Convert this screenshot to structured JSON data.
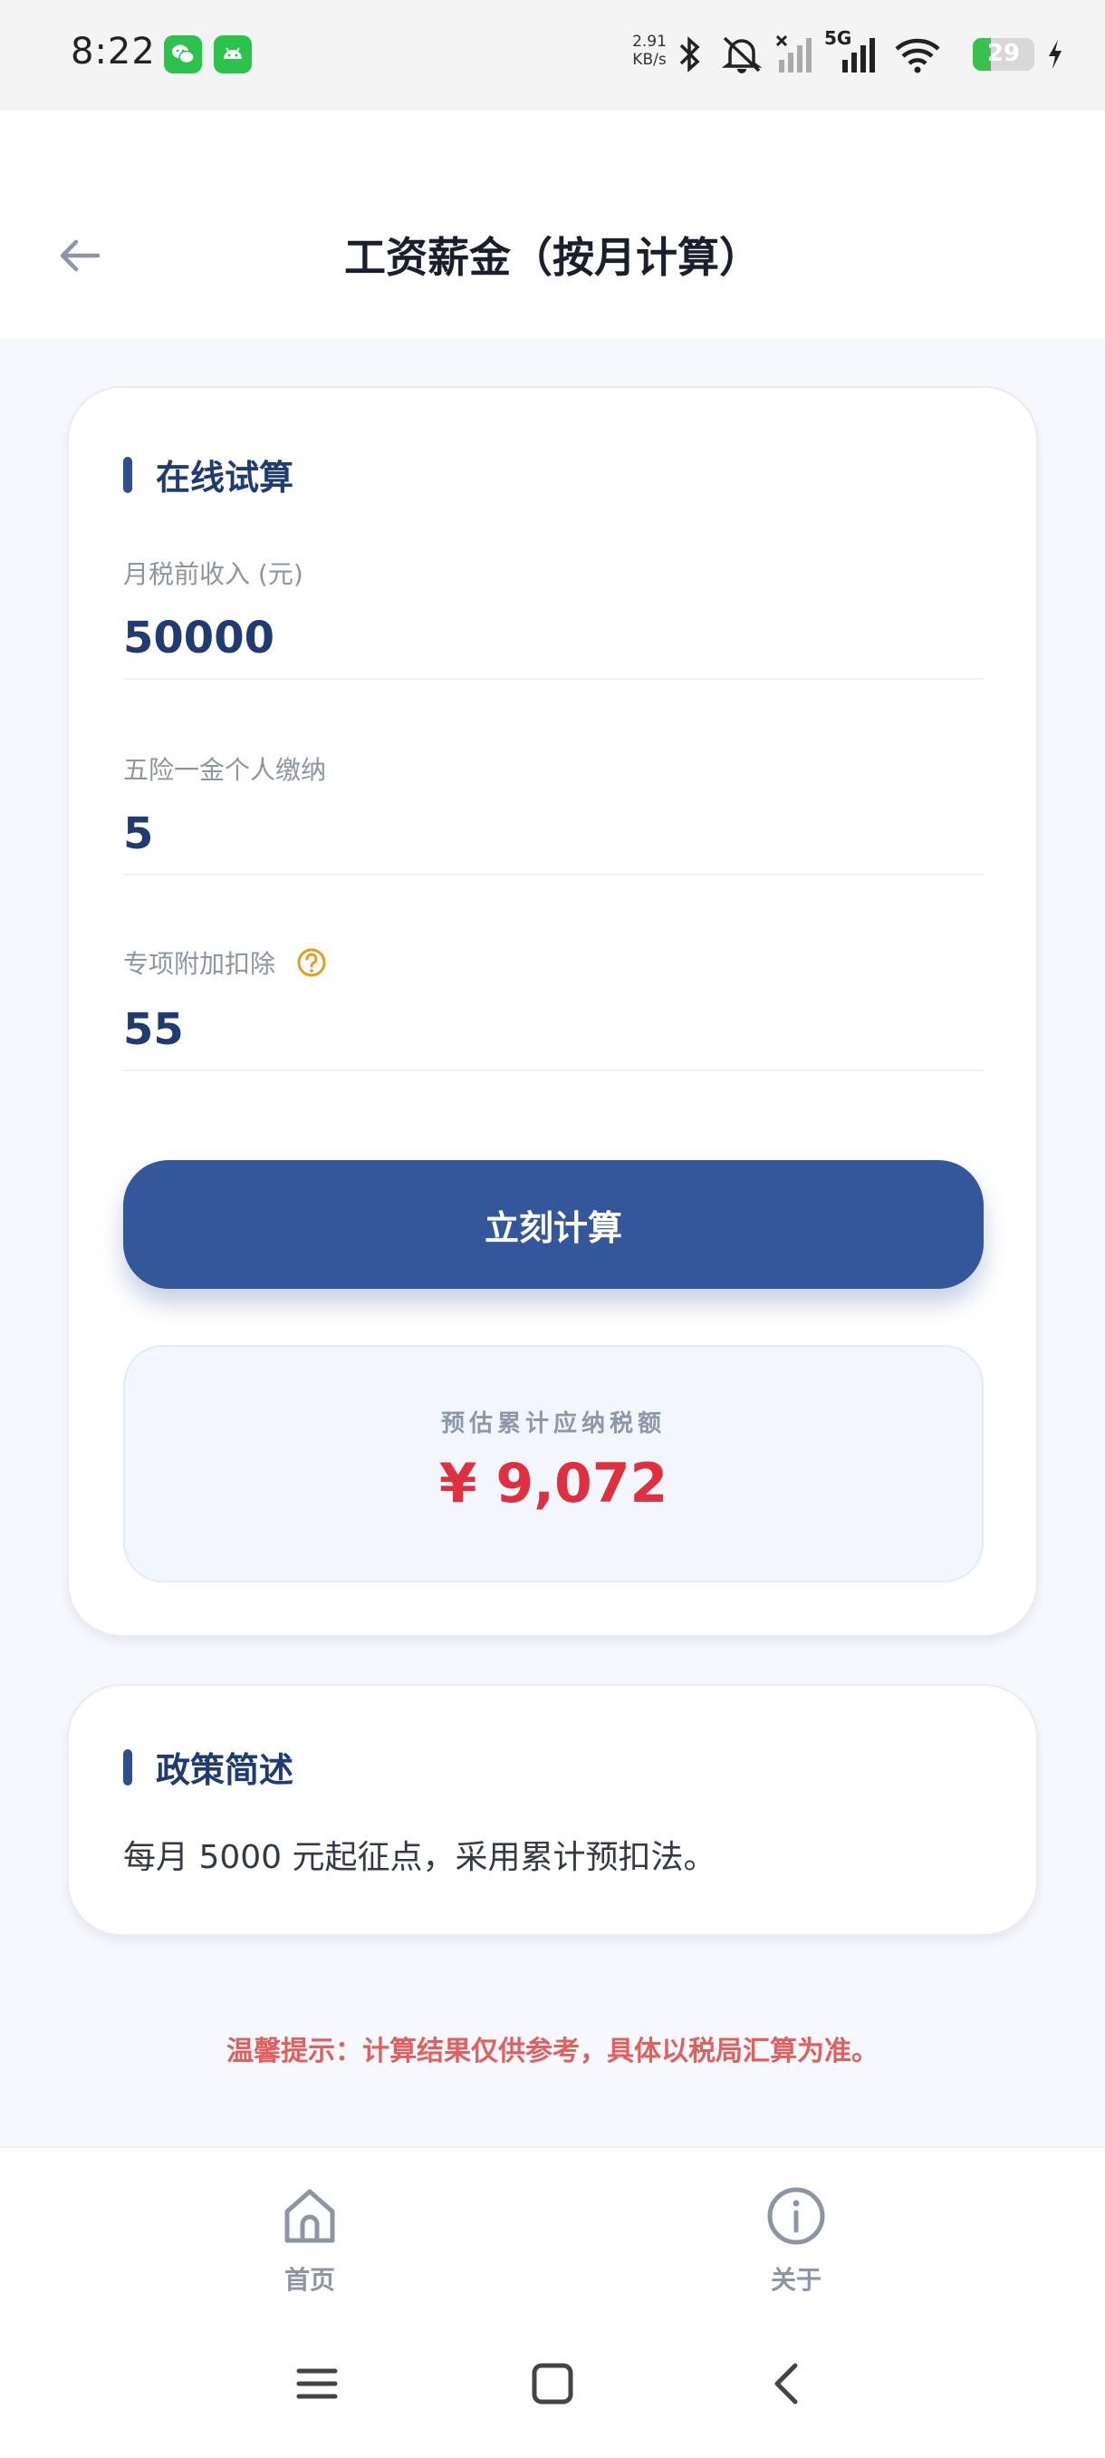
{
  "status_bar": {
    "time": "8:22",
    "net_speed_value": "2.91",
    "net_speed_unit": "KB/s",
    "network_type": "5G",
    "battery_level": "29",
    "battery_fraction": 0.29
  },
  "header": {
    "title": "工资薪金（按月计算）"
  },
  "calculator": {
    "section_title": "在线试算",
    "income_label": "月税前收入 (元)",
    "income_value": "50000",
    "insurance_label": "五险一金个人缴纳",
    "insurance_value": "5",
    "deduction_label": "专项附加扣除",
    "deduction_value": "55",
    "calc_button_label": "立刻计算",
    "result_label": "预估累计应纳税额",
    "result_value": "¥ 9,072"
  },
  "policy": {
    "section_title": "政策简述",
    "text": "每月 5000 元起征点，采用累计预扣法。"
  },
  "tip": "温馨提示：计算结果仅供参考，具体以税局汇算为准。",
  "bottom_nav": {
    "items": [
      {
        "label": "首页",
        "icon": "home-icon"
      },
      {
        "label": "关于",
        "icon": "info-icon"
      }
    ]
  },
  "colors": {
    "primary": "#34569a",
    "title_blue": "#1f3b72",
    "result_red": "#e03040",
    "tip_red": "#e06060",
    "help_orange": "#e0a020"
  }
}
